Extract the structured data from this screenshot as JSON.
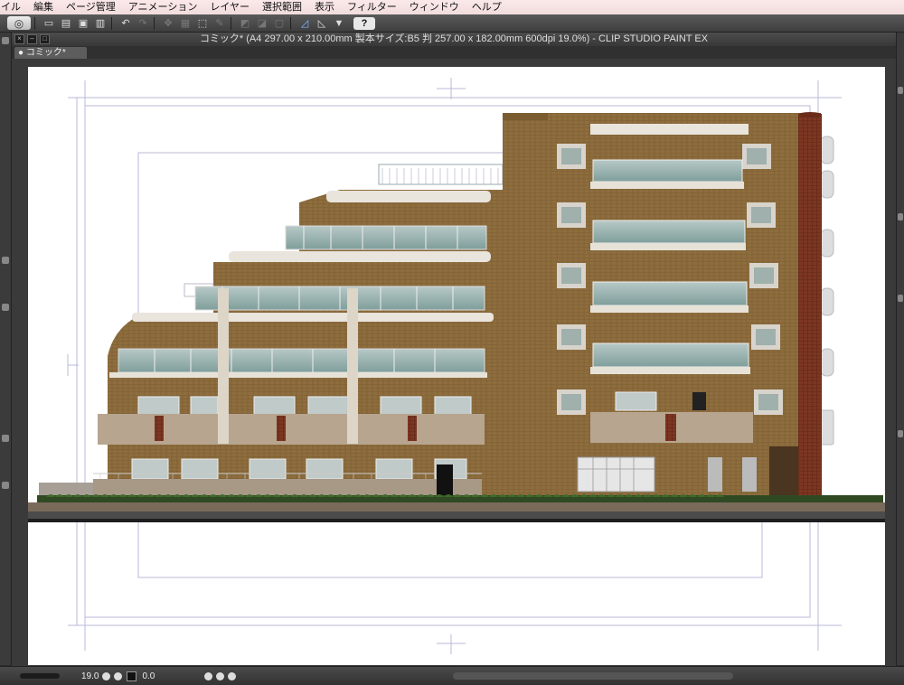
{
  "menu": [
    "イル",
    "編集",
    "ページ管理",
    "アニメーション",
    "レイヤー",
    "選択範囲",
    "表示",
    "フィルター",
    "ウィンドウ",
    "ヘルプ"
  ],
  "toolbar": {
    "icons": [
      "clip-studio-logo-icon",
      "new-file-icon",
      "open-file-icon",
      "save-icon",
      "print-icon",
      "undo-icon",
      "redo-icon",
      "clear-icon",
      "fill-icon",
      "transform-icon",
      "move-icon",
      "selection-icon",
      "ruler-snap-icon",
      "perspective-snap-icon",
      "special-ruler-snap-icon",
      "help-icon"
    ],
    "help_label": "?"
  },
  "window": {
    "title": "コミック* (A4 297.00 x 210.00mm 製本サイズ:B5 判 257.00 x 182.00mm 600dpi 19.0%)  - CLIP STUDIO PAINT EX",
    "tab_label": "コミック*"
  },
  "status": {
    "zoom": "19.0",
    "rotation": "0.0"
  },
  "colors": {
    "accent_menu_bg": "#f4e2e3",
    "chrome_dark": "#3b3b3b",
    "brick": "#8a6a3c",
    "pillar": "#7a3520"
  }
}
